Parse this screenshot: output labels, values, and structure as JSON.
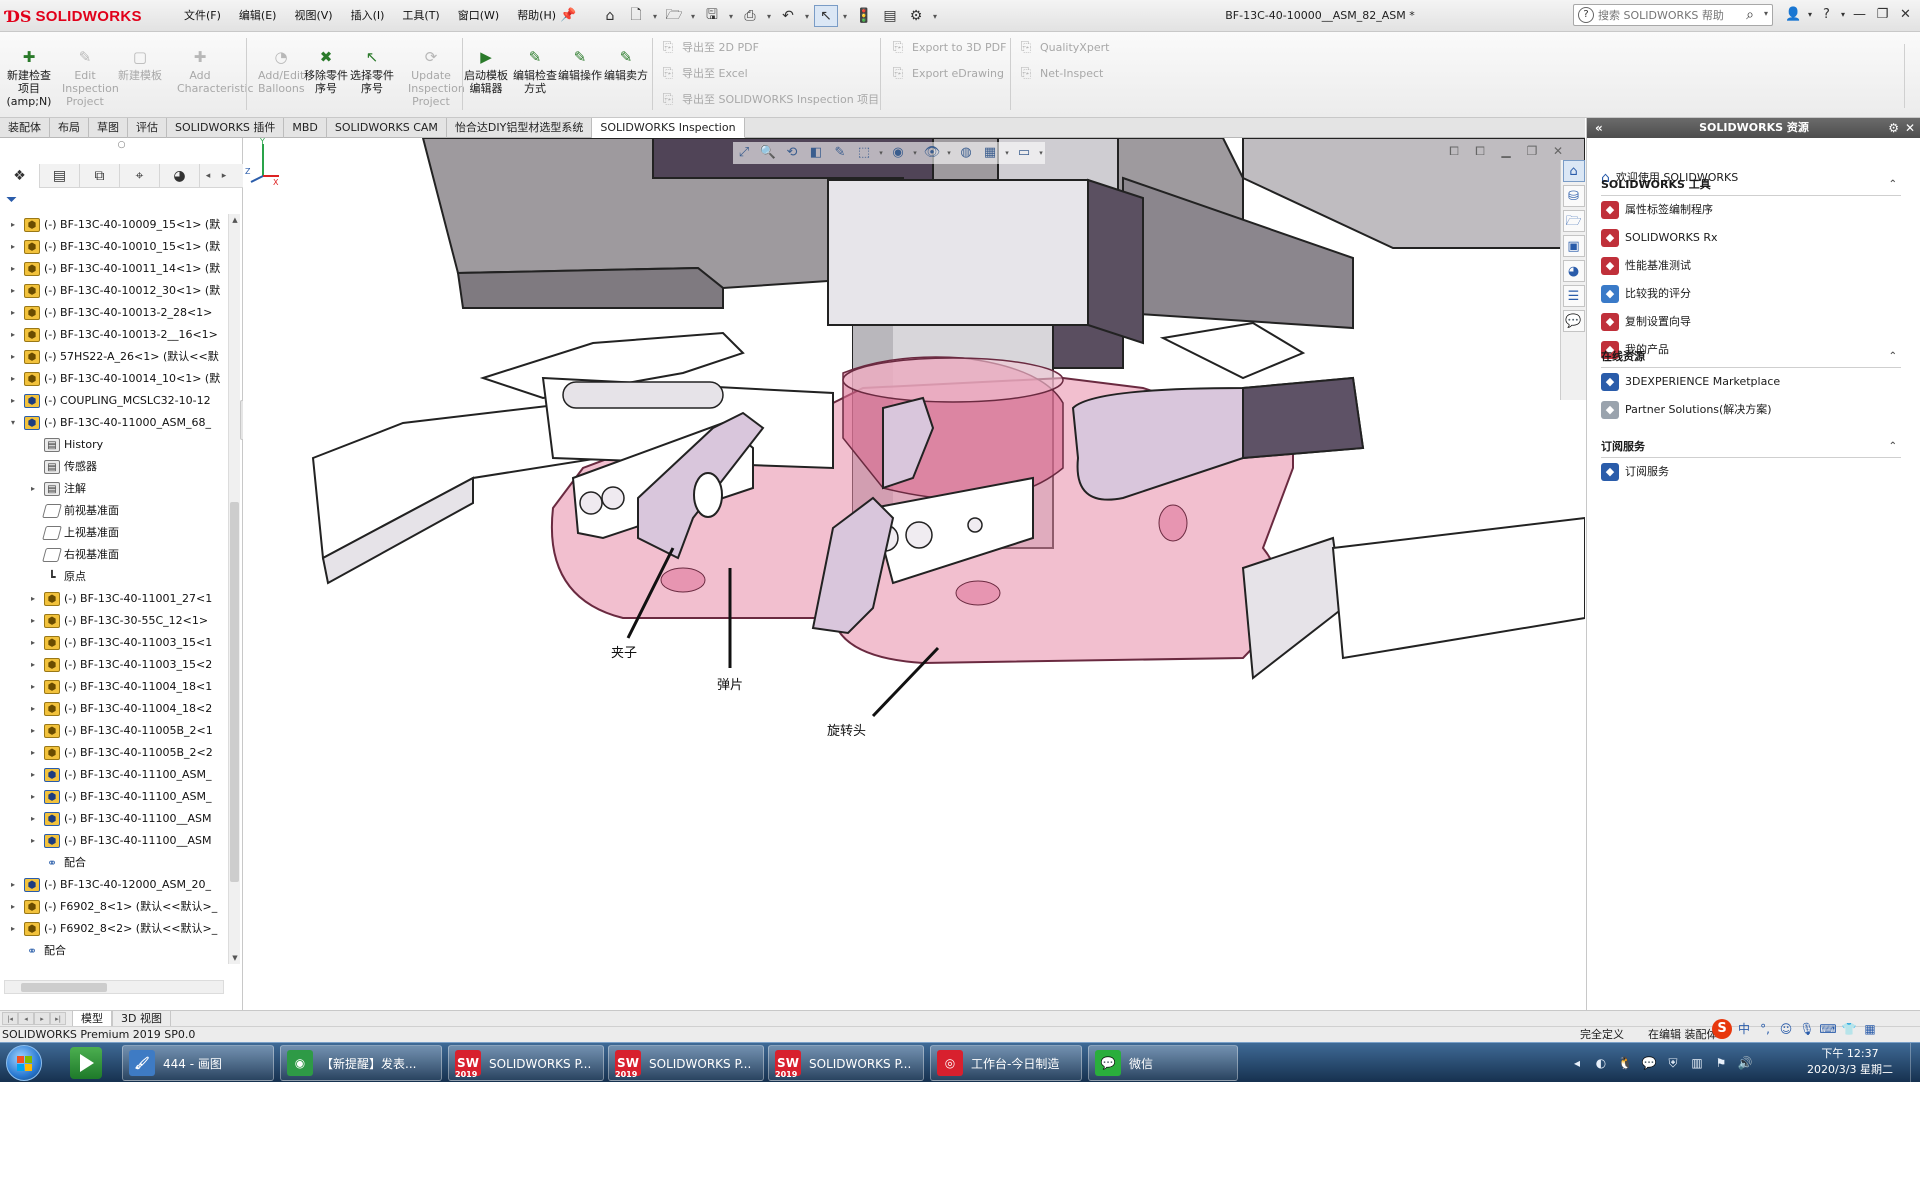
{
  "app": {
    "logo_text": "SOLIDWORKS",
    "document_title": "BF-13C-40-10000__ASM_82_ASM *"
  },
  "menu": [
    "文件(F)",
    "编辑(E)",
    "视图(V)",
    "插入(I)",
    "工具(T)",
    "窗口(W)",
    "帮助(H)"
  ],
  "help_search": {
    "placeholder": "搜索 SOLIDWORKS 帮助"
  },
  "ribbon": {
    "buttons": [
      {
        "label": "新建检查项目(amp;N)",
        "enabled": true,
        "icon": "new-inspection-icon"
      },
      {
        "label": "Edit Inspection Project",
        "enabled": false,
        "icon": "edit-inspection-icon"
      },
      {
        "label": "新建模板",
        "enabled": false,
        "icon": "new-template-icon"
      },
      {
        "label": "Add Characteristic",
        "enabled": false,
        "icon": "add-characteristic-icon"
      },
      {
        "label": "Add/Edit Balloons",
        "enabled": false,
        "icon": "balloons-icon"
      },
      {
        "label": "移除零件序号",
        "enabled": true,
        "icon": "remove-balloon-icon"
      },
      {
        "label": "选择零件序号",
        "enabled": true,
        "icon": "select-balloon-icon"
      },
      {
        "label": "Update Inspection Project",
        "enabled": false,
        "icon": "update-inspection-icon"
      },
      {
        "label": "启动模板编辑器",
        "enabled": true,
        "icon": "template-editor-icon"
      },
      {
        "label": "编辑检查方式",
        "enabled": true,
        "icon": "edit-method-icon"
      },
      {
        "label": "编辑操作",
        "enabled": true,
        "icon": "edit-operation-icon"
      },
      {
        "label": "编辑卖方",
        "enabled": true,
        "icon": "edit-vendor-icon"
      }
    ],
    "exports_left": [
      "导出至 2D PDF",
      "导出至 Excel",
      "导出至 SOLIDWORKS Inspection 项目"
    ],
    "exports_mid": [
      "Export to 3D PDF",
      "Export eDrawing"
    ],
    "exports_right": [
      "QualityXpert",
      "Net-Inspect"
    ]
  },
  "cm_tabs": [
    "装配体",
    "布局",
    "草图",
    "评估",
    "SOLIDWORKS 插件",
    "MBD",
    "SOLIDWORKS CAM",
    "怡合达DIY铝型材选型系统",
    "SOLIDWORKS Inspection"
  ],
  "cm_active_tab": "SOLIDWORKS Inspection",
  "feature_tree": [
    {
      "level": 0,
      "expand": "▸",
      "icon": "asm",
      "label": "(-) BF-13C-40-10009_15<1> (默"
    },
    {
      "level": 0,
      "expand": "▸",
      "icon": "asm",
      "label": "(-) BF-13C-40-10010_15<1> (默"
    },
    {
      "level": 0,
      "expand": "▸",
      "icon": "asm",
      "label": "(-) BF-13C-40-10011_14<1> (默"
    },
    {
      "level": 0,
      "expand": "▸",
      "icon": "asm",
      "label": "(-) BF-13C-40-10012_30<1> (默"
    },
    {
      "level": 0,
      "expand": "▸",
      "icon": "asm",
      "label": "(-) BF-13C-40-10013-2_28<1>"
    },
    {
      "level": 0,
      "expand": "▸",
      "icon": "asm",
      "label": "(-) BF-13C-40-10013-2__16<1>"
    },
    {
      "level": 0,
      "expand": "▸",
      "icon": "asm",
      "label": "(-) 57HS22-A_26<1> (默认<<默"
    },
    {
      "level": 0,
      "expand": "▸",
      "icon": "asm",
      "label": "(-) BF-13C-40-10014_10<1> (默"
    },
    {
      "level": 0,
      "expand": "▸",
      "icon": "asm2",
      "label": "(-) COUPLING_MCSLC32-10-12"
    },
    {
      "level": 0,
      "expand": "▾",
      "icon": "asm2",
      "label": "(-) BF-13C-40-11000_ASM_68_"
    },
    {
      "level": 1,
      "expand": "",
      "icon": "fold",
      "label": "History"
    },
    {
      "level": 1,
      "expand": "",
      "icon": "fold",
      "label": "传感器"
    },
    {
      "level": 1,
      "expand": "▸",
      "icon": "fold",
      "label": "注解"
    },
    {
      "level": 1,
      "expand": "",
      "icon": "plane",
      "label": "前视基准面"
    },
    {
      "level": 1,
      "expand": "",
      "icon": "plane",
      "label": "上视基准面"
    },
    {
      "level": 1,
      "expand": "",
      "icon": "plane",
      "label": "右视基准面"
    },
    {
      "level": 1,
      "expand": "",
      "icon": "orig",
      "label": "原点"
    },
    {
      "level": 1,
      "expand": "▸",
      "icon": "asm",
      "label": "(-) BF-13C-40-11001_27<1"
    },
    {
      "level": 1,
      "expand": "▸",
      "icon": "asm",
      "label": "(-) BF-13C-30-55C_12<1>"
    },
    {
      "level": 1,
      "expand": "▸",
      "icon": "asm",
      "label": "(-) BF-13C-40-11003_15<1"
    },
    {
      "level": 1,
      "expand": "▸",
      "icon": "asm",
      "label": "(-) BF-13C-40-11003_15<2"
    },
    {
      "level": 1,
      "expand": "▸",
      "icon": "asm",
      "label": "(-) BF-13C-40-11004_18<1"
    },
    {
      "level": 1,
      "expand": "▸",
      "icon": "asm",
      "label": "(-) BF-13C-40-11004_18<2"
    },
    {
      "level": 1,
      "expand": "▸",
      "icon": "asm",
      "label": "(-) BF-13C-40-11005B_2<1"
    },
    {
      "level": 1,
      "expand": "▸",
      "icon": "asm",
      "label": "(-) BF-13C-40-11005B_2<2"
    },
    {
      "level": 1,
      "expand": "▸",
      "icon": "asm2",
      "label": "(-) BF-13C-40-11100_ASM_"
    },
    {
      "level": 1,
      "expand": "▸",
      "icon": "asm2",
      "label": "(-) BF-13C-40-11100_ASM_"
    },
    {
      "level": 1,
      "expand": "▸",
      "icon": "asm2",
      "label": "(-) BF-13C-40-11100__ASM"
    },
    {
      "level": 1,
      "expand": "▸",
      "icon": "asm2",
      "label": "(-) BF-13C-40-11100__ASM"
    },
    {
      "level": 1,
      "expand": "",
      "icon": "mate",
      "label": "配合"
    },
    {
      "level": 0,
      "expand": "▸",
      "icon": "asm2",
      "label": "(-) BF-13C-40-12000_ASM_20_"
    },
    {
      "level": 0,
      "expand": "▸",
      "icon": "asm",
      "label": "(-) F6902_8<1> (默认<<默认>_"
    },
    {
      "level": 0,
      "expand": "▸",
      "icon": "asm",
      "label": "(-) F6902_8<2> (默认<<默认>_"
    },
    {
      "level": 0,
      "expand": "",
      "icon": "mate",
      "label": "配合"
    }
  ],
  "callouts": {
    "clip": "夹子",
    "spring": "弹片",
    "rotary_head": "旋转头"
  },
  "task_pane": {
    "title": "SOLIDWORKS 资源",
    "welcome": "欢迎使用 SOLIDWORKS",
    "sections": [
      {
        "title": "SOLIDWORKS 工具",
        "items": [
          "属性标签编制程序",
          "SOLIDWORKS Rx",
          "性能基准测试",
          "比较我的评分",
          "复制设置向导",
          "我的产品"
        ]
      },
      {
        "title": "在线资源",
        "items": [
          "3DEXPERIENCE Marketplace",
          "Partner Solutions(解决方案)"
        ]
      },
      {
        "title": "订阅服务",
        "items": [
          "订阅服务"
        ]
      }
    ]
  },
  "sheet_tabs": [
    "模型",
    "3D 视图"
  ],
  "status": {
    "left": "SOLIDWORKS Premium 2019 SP0.0",
    "defined": "完全定义",
    "editing": "在编辑 装配体"
  },
  "ime": {
    "brand": "S",
    "mode": "中"
  },
  "taskbar": {
    "items": [
      {
        "label": "444 - 画图",
        "icon": "paint-icon",
        "color": "#3e7bc4"
      },
      {
        "label": "【新提醒】发表...",
        "icon": "chrome-icon",
        "color": "#2e9a46"
      },
      {
        "label": "SOLIDWORKS P...",
        "icon": "solidworks-icon",
        "color": "#d8202e"
      },
      {
        "label": "SOLIDWORKS P...",
        "icon": "solidworks-icon",
        "color": "#d8202e"
      },
      {
        "label": "SOLIDWORKS P...",
        "icon": "solidworks-icon",
        "color": "#d8202e"
      },
      {
        "label": "工作台-今日制造",
        "icon": "workbench-icon",
        "color": "#d8202e"
      },
      {
        "label": "微信",
        "icon": "wechat-icon",
        "color": "#2aae3c"
      }
    ],
    "sw_badge": "2019",
    "time": "下午 12:37",
    "date": "2020/3/3 星期二"
  },
  "colors": {
    "accent_red": "#e1001a",
    "pink_transparent": "#e88aa8",
    "part_lavender": "#d9c6dc",
    "dark_purple": "#554659"
  }
}
